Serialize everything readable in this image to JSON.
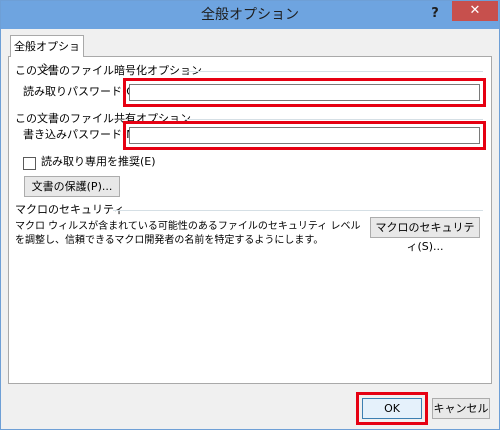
{
  "window": {
    "title": "全般オプション",
    "help_glyph": "?",
    "close_glyph": "✕"
  },
  "tab": {
    "label": "全般オプション"
  },
  "encryption": {
    "heading": "この文書のファイル暗号化オプション",
    "password_label": "読み取りパスワード(O):",
    "password_value": ""
  },
  "sharing": {
    "heading": "この文書のファイル共有オプション",
    "password_label": "書き込みパスワード(M):",
    "password_value": "",
    "readonly_label": "読み取り専用を推奨(E)",
    "readonly_checked": false,
    "protect_button": "文書の保護(P)..."
  },
  "macro": {
    "heading": "マクロのセキュリティ",
    "description": "マクロ ウィルスが含まれている可能性のあるファイルのセキュリティ レベルを調整し、信頼できるマクロ開発者の名前を特定するようにします。",
    "button": "マクロのセキュリティ(S)..."
  },
  "footer": {
    "ok": "OK",
    "cancel": "キャンセル"
  },
  "colors": {
    "highlight": "#e60012",
    "titlebar": "#6ea4e0",
    "close": "#c7504d"
  }
}
